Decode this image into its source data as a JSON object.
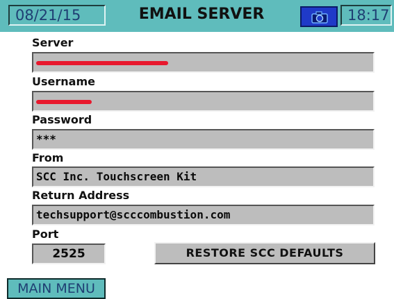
{
  "header": {
    "date": "08/21/15",
    "title": "EMAIL SERVER",
    "camera_icon": "camera-icon",
    "time": "18:17"
  },
  "form": {
    "server_label": "Server",
    "server_value": "",
    "username_label": "Username",
    "username_value": "",
    "password_label": "Password",
    "password_value": "***",
    "from_label": "From",
    "from_value": "SCC Inc. Touchscreen Kit",
    "return_label": "Return Address",
    "return_value": "techsupport@scccombustion.com",
    "port_label": "Port",
    "port_value": "2525"
  },
  "buttons": {
    "restore_label": "RESTORE SCC DEFAULTS",
    "main_menu_label": "MAIN MENU"
  },
  "colors": {
    "header_bg": "#5fbcbc",
    "field_bg": "#bdbdbd",
    "camera_bg": "#1f3ac8",
    "redaction": "#e8182d"
  }
}
